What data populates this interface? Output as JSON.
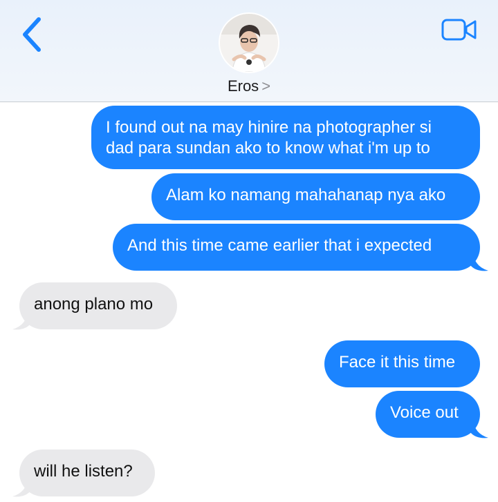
{
  "header": {
    "contact_name": "Eros",
    "contact_chevron": ">",
    "avatar_icon": "person-avatar",
    "back_icon": "chevron-left-icon",
    "video_icon": "video-camera-icon",
    "accent_color": "#1b84ff"
  },
  "messages": [
    {
      "direction": "outgoing",
      "lines": [
        "I found out na may hinire na photographer si",
        "dad para sundan ako to know what i'm up to"
      ]
    },
    {
      "direction": "outgoing",
      "lines": [
        "Alam ko namang mahahanap nya ako"
      ]
    },
    {
      "direction": "outgoing",
      "lines": [
        "And this time came earlier that i expected"
      ]
    },
    {
      "direction": "incoming",
      "lines": [
        "anong plano mo"
      ]
    },
    {
      "direction": "outgoing",
      "lines": [
        "Face it this time"
      ]
    },
    {
      "direction": "outgoing",
      "lines": [
        "Voice out"
      ]
    },
    {
      "direction": "incoming",
      "lines": [
        "will he listen?"
      ]
    }
  ],
  "colors": {
    "outgoing_bubble": "#1b84ff",
    "incoming_bubble": "#e9e9eb",
    "header_background": "#eaf1fb"
  }
}
